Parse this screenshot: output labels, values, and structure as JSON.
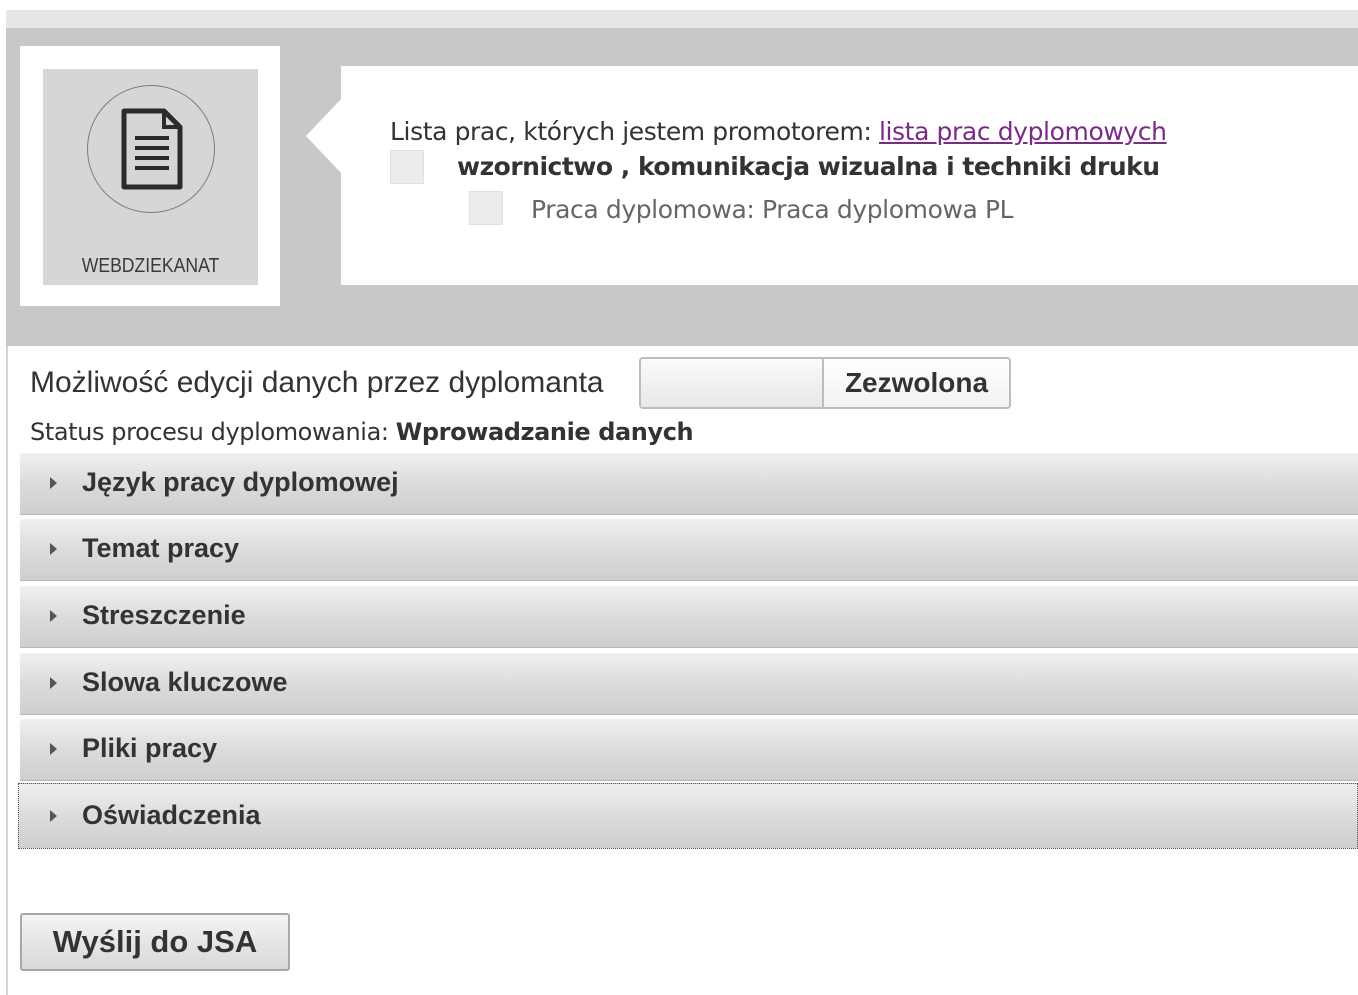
{
  "module": {
    "label": "WEBDZIEKANAT",
    "icon": "document-icon"
  },
  "info": {
    "promoter_text": "Lista prac, których jestem promotorem: ",
    "promoter_link": "lista prac dyplomowych",
    "field_of_study": "wzornictwo , komunikacja wizualna i techniki druku",
    "thesis": "Praca dyplomowa: Praca dyplomowa PL"
  },
  "edit_permission": {
    "label": "Możliwość edycji danych przez dyplomanta",
    "value": "Zezwolona"
  },
  "status": {
    "label": "Status procesu dyplomowania: ",
    "value": "Wprowadzanie danych"
  },
  "sections": [
    "Język pracy dyplomowej",
    "Temat pracy",
    "Streszczenie",
    "Slowa kluczowe",
    "Pliki pracy",
    "Oświadczenia"
  ],
  "send_button": "Wyślij do JSA",
  "colors": {
    "link": "#7b2a86",
    "header_band": "#c8c8c8"
  }
}
